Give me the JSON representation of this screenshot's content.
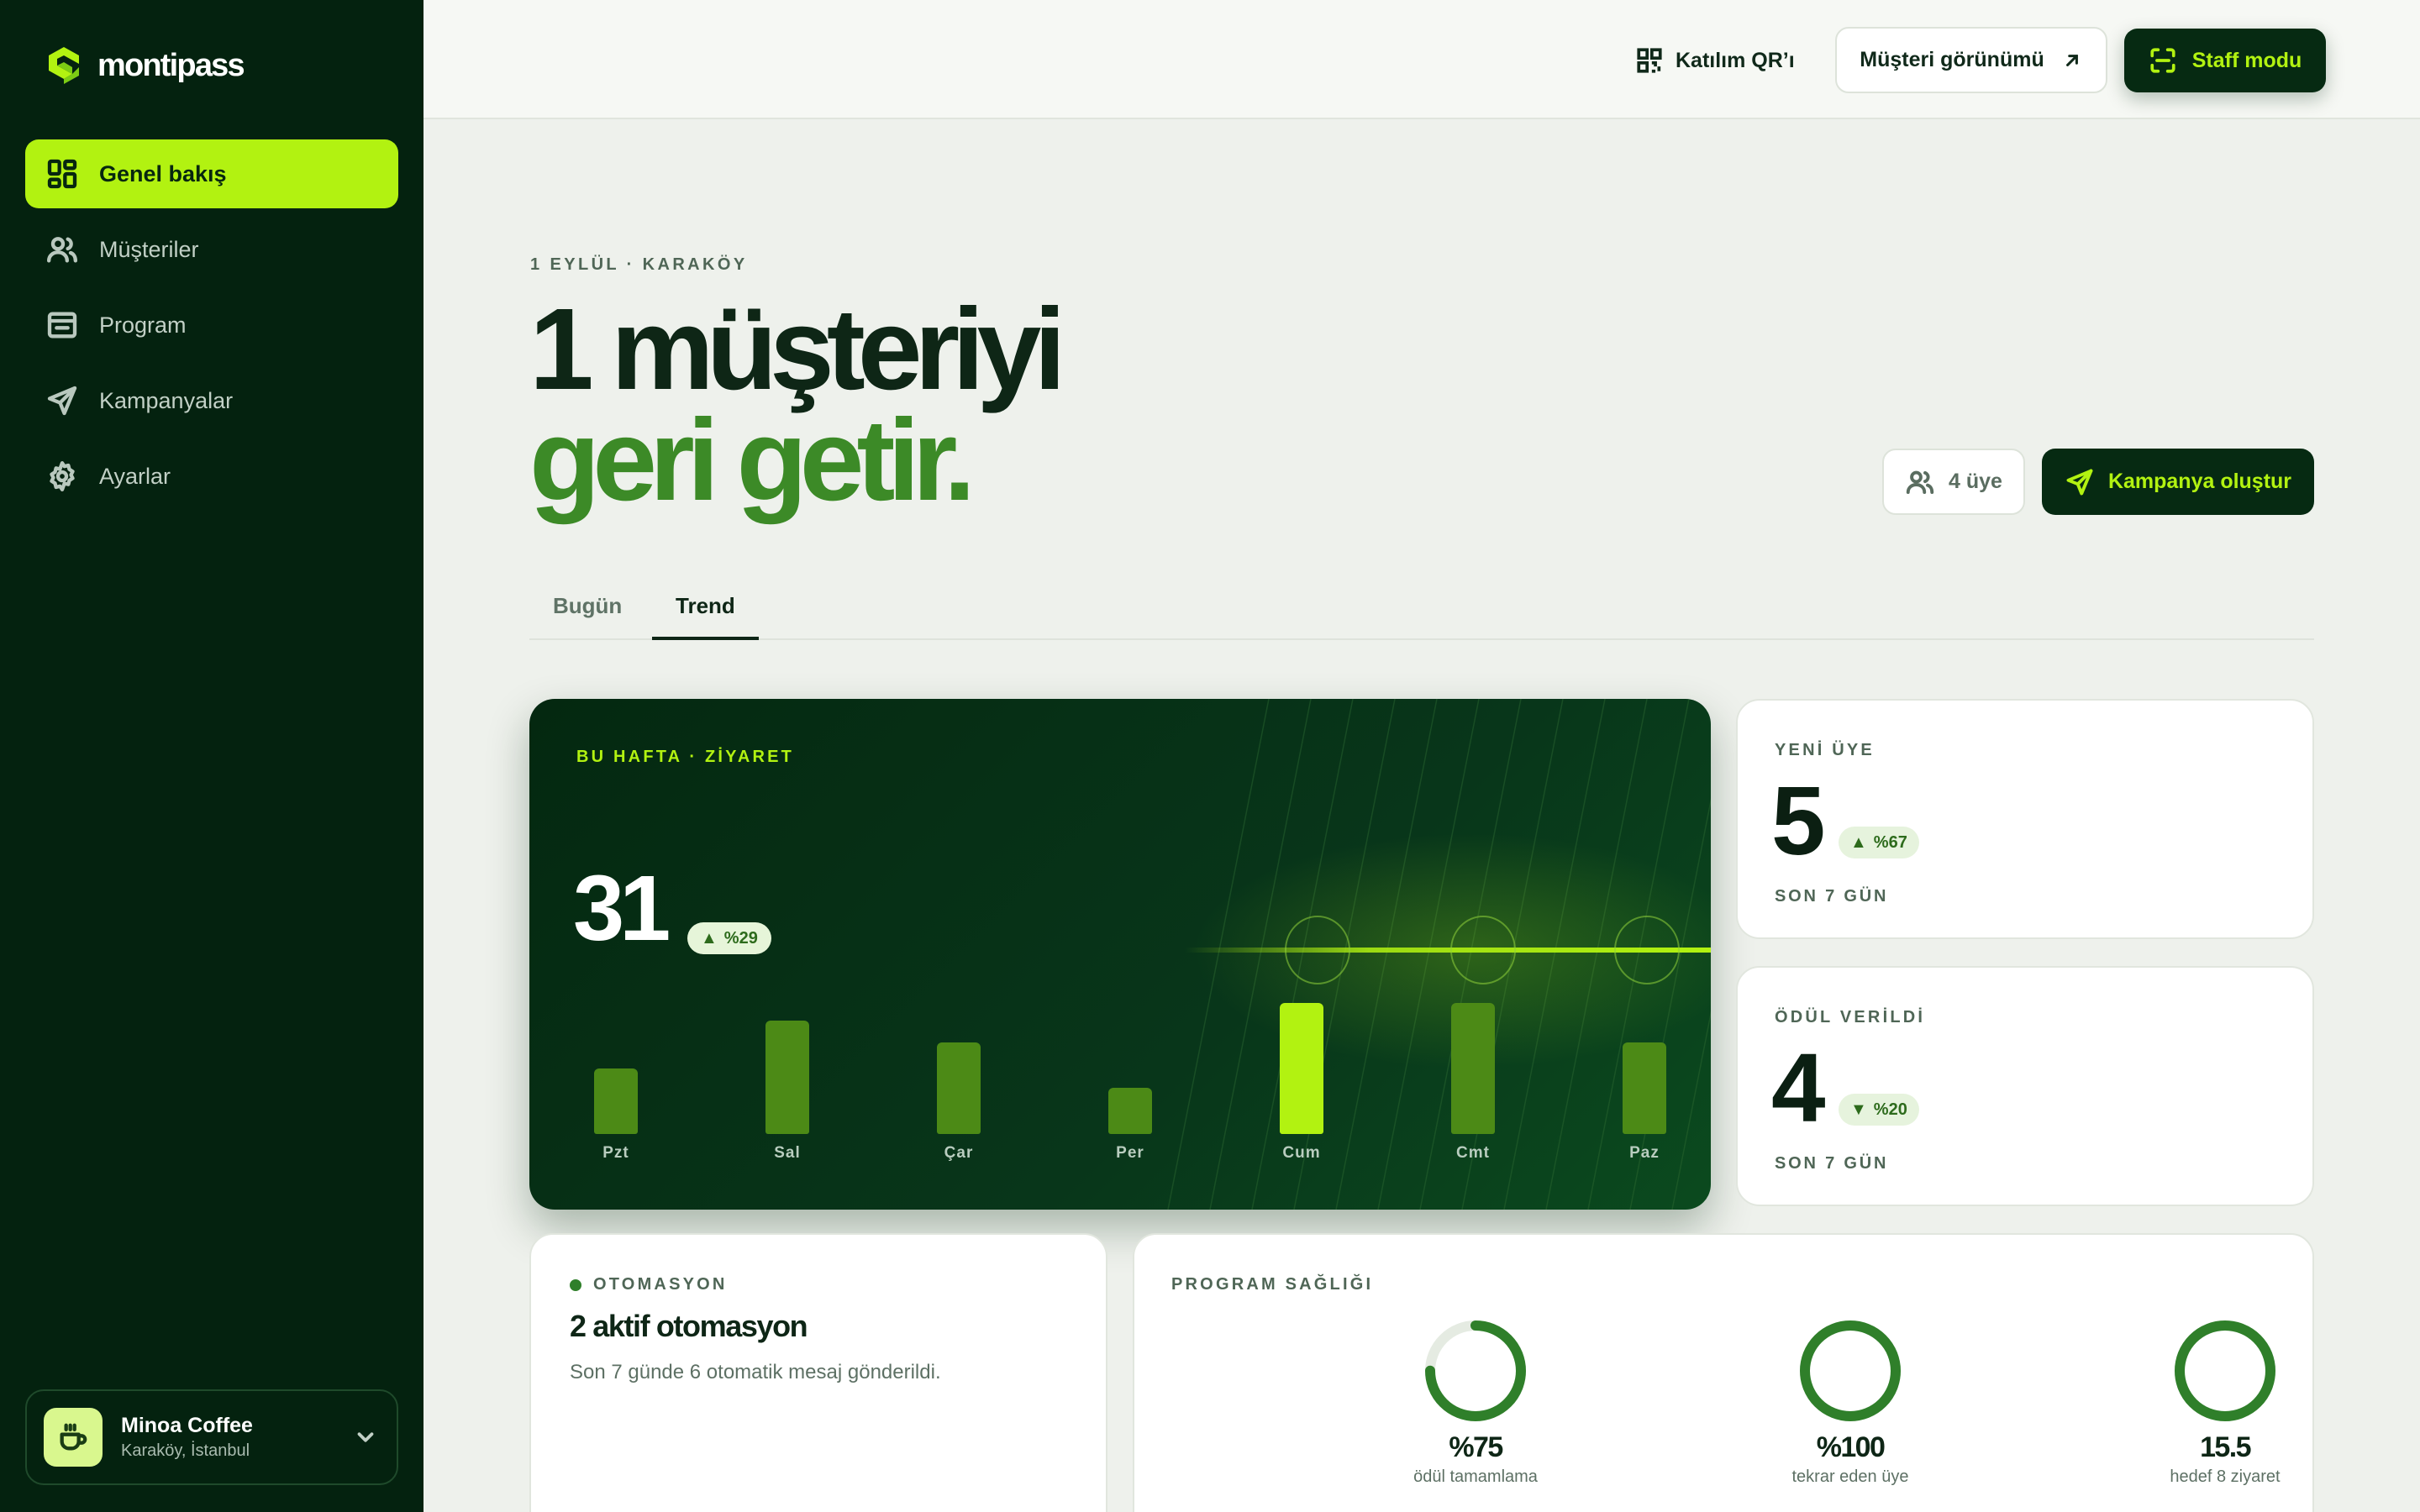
{
  "brand": {
    "name": "montipass",
    "accent": "#b2f211",
    "dark": "#04220f"
  },
  "sidebar": {
    "items": [
      {
        "label": "Genel bakış",
        "icon": "dashboard-icon",
        "active": true
      },
      {
        "label": "Müşteriler",
        "icon": "users-icon",
        "active": false
      },
      {
        "label": "Program",
        "icon": "program-icon",
        "active": false
      },
      {
        "label": "Kampanyalar",
        "icon": "send-icon",
        "active": false
      },
      {
        "label": "Ayarlar",
        "icon": "gear-icon",
        "active": false
      }
    ],
    "venue": {
      "name": "Minoa Coffee",
      "location": "Karaköy, İstanbul",
      "icon": "coffee-cup-icon"
    }
  },
  "topbar": {
    "qr_label": "Katılım QR’ı",
    "customer_view_label": "Müşteri görünümü",
    "staff_mode_label": "Staff modu"
  },
  "hero": {
    "eyebrow": "1 EYLÜL · KARAKÖY",
    "title_line1": "1 müşteriyi",
    "title_line2": "geri getir.",
    "members_label": "4 üye",
    "campaign_button": "Kampanya oluştur"
  },
  "tabs": [
    {
      "label": "Bugün",
      "active": false
    },
    {
      "label": "Trend",
      "active": true
    }
  ],
  "weekly": {
    "label": "BU HAFTA · ZİYARET",
    "total": "31",
    "change": "%29",
    "change_direction": "up"
  },
  "chart_data": {
    "type": "bar",
    "categories": [
      "Pzt",
      "Sal",
      "Çar",
      "Per",
      "Cum",
      "Cmt",
      "Paz"
    ],
    "values": [
      3,
      5.2,
      4.2,
      2.1,
      6,
      6,
      4.2
    ],
    "highlight_index": 4,
    "ylim": [
      0,
      6
    ]
  },
  "stats": [
    {
      "label": "YENİ ÜYE",
      "value": "5",
      "change": "%67",
      "direction": "up",
      "period": "SON 7 GÜN"
    },
    {
      "label": "ÖDÜL VERİLDİ",
      "value": "4",
      "change": "%20",
      "direction": "down",
      "period": "SON 7 GÜN"
    }
  ],
  "automation": {
    "label": "OTOMASYON",
    "title": "2 aktif otomasyon",
    "description": "Son 7 günde 6 otomatik mesaj gönderildi."
  },
  "program_health": {
    "label": "PROGRAM SAĞLIĞI",
    "rings": [
      {
        "value": "%75",
        "caption": "ödül tamamlama",
        "fraction": 0.75
      },
      {
        "value": "%100",
        "caption": "tekrar eden üye",
        "fraction": 1.0
      },
      {
        "value": "15.5",
        "caption": "hedef 8 ziyaret",
        "fraction": 1.0
      }
    ]
  }
}
